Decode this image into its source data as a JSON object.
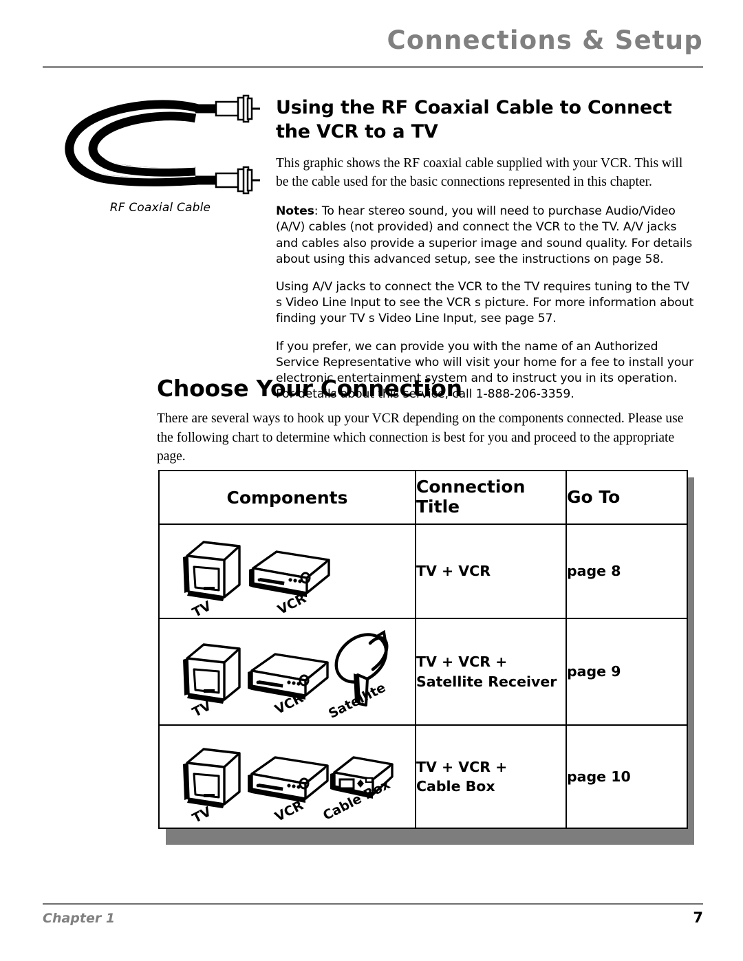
{
  "header": {
    "running_title": "Connections & Setup"
  },
  "figure": {
    "caption": "RF Coaxial Cable",
    "icon": "rf-coaxial-cable"
  },
  "section": {
    "title": "Using the RF Coaxial Cable to Connect the VCR to a TV",
    "intro": "This graphic shows the RF coaxial cable supplied with your VCR. This will be the cable used for the basic connections represented in this chapter.",
    "notes_label": "Notes",
    "notes_body": ": To hear stereo sound, you will need to purchase Audio/Video (A/V) cables (not provided) and connect the VCR to the TV. A/V jacks and cables also provide a superior image and sound quality. For details about using this advanced setup, see the instructions on page 58.",
    "para_av": "Using A/V jacks to connect the VCR to the TV requires tuning to the TV s Video Line Input to see the VCR s picture. For more information about finding your TV s Video Line Input, see page 57.",
    "para_service": "If you prefer, we can provide you with the name of an Authorized Service Representative who will visit your home for a fee to install your electronic entertainment system and to instruct you in its operation. For details about this service, call 1-888-206-3359."
  },
  "choose": {
    "title": "Choose Your Connection",
    "intro": "There are several ways to hook up your VCR depending on the components connected. Please use the following chart to determine which connection is best for you and proceed to the appropriate page."
  },
  "chart_data": {
    "type": "table",
    "title": "Choose Your Connection",
    "columns": [
      "Components",
      "Connection Title",
      "Go To"
    ],
    "headers": {
      "components": "Components",
      "connection_title_line1": "Connection",
      "connection_title_line2": "Title",
      "go_to": "Go To"
    },
    "rows": [
      {
        "devices": [
          "TV",
          "VCR"
        ],
        "device_icons": [
          "tv-icon",
          "vcr-icon"
        ],
        "connection_title_line1": "TV + VCR",
        "connection_title_line2": "",
        "go_to": "page 8"
      },
      {
        "devices": [
          "TV",
          "VCR",
          "Satellite"
        ],
        "device_icons": [
          "tv-icon",
          "vcr-icon",
          "satellite-dish-icon"
        ],
        "connection_title_line1": "TV + VCR +",
        "connection_title_line2": "Satellite Receiver",
        "go_to": "page 9"
      },
      {
        "devices": [
          "TV",
          "VCR",
          "Cable Box"
        ],
        "device_icons": [
          "tv-icon",
          "vcr-icon",
          "cable-box-icon"
        ],
        "connection_title_line1": "TV + VCR +",
        "connection_title_line2": "Cable Box",
        "go_to": "page 10"
      }
    ]
  },
  "footer": {
    "chapter": "Chapter 1",
    "page_number": "7"
  },
  "colors": {
    "header_gray": "#808080",
    "rule_gray": "#8d8d8d",
    "shadow_gray": "#7d7d7d",
    "text_black": "#000000"
  }
}
